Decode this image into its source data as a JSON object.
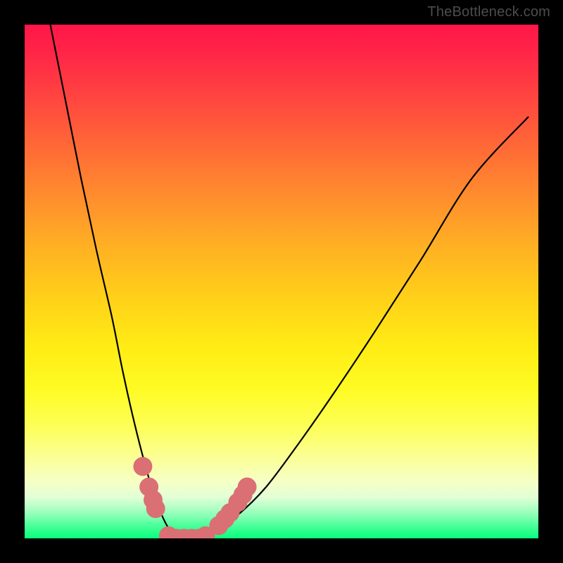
{
  "watermark": "TheBottleneck.com",
  "chart_data": {
    "type": "line",
    "title": "",
    "xlabel": "",
    "ylabel": "",
    "xlim": [
      0,
      100
    ],
    "ylim": [
      0,
      100
    ],
    "grid": false,
    "legend": false,
    "series": [
      {
        "name": "bottleneck-curve",
        "color": "#000000",
        "x": [
          5,
          8,
          11,
          14,
          17,
          19,
          21,
          23,
          25,
          26.5,
          28,
          29.5,
          31,
          33,
          35,
          38,
          42,
          47,
          53,
          60,
          68,
          77,
          87,
          98
        ],
        "y": [
          100,
          85,
          70,
          56,
          43,
          33,
          24,
          16,
          9,
          5,
          2,
          0.5,
          0,
          0,
          0.5,
          2,
          5,
          10,
          18,
          28,
          40,
          54,
          70,
          82
        ]
      }
    ],
    "markers": [
      {
        "x": 23.0,
        "y": 14.0,
        "r": 1.3
      },
      {
        "x": 24.2,
        "y": 10.0,
        "r": 1.3
      },
      {
        "x": 25.0,
        "y": 7.5,
        "r": 1.3
      },
      {
        "x": 25.5,
        "y": 5.8,
        "r": 1.3
      },
      {
        "x": 28.0,
        "y": 0.5,
        "r": 1.3
      },
      {
        "x": 29.5,
        "y": 0.0,
        "r": 1.3
      },
      {
        "x": 31.0,
        "y": 0.0,
        "r": 1.3
      },
      {
        "x": 32.5,
        "y": 0.0,
        "r": 1.3
      },
      {
        "x": 34.0,
        "y": 0.0,
        "r": 1.3
      },
      {
        "x": 35.2,
        "y": 0.5,
        "r": 1.3
      },
      {
        "x": 37.8,
        "y": 2.5,
        "r": 1.3
      },
      {
        "x": 39.0,
        "y": 3.8,
        "r": 1.3
      },
      {
        "x": 40.0,
        "y": 5.0,
        "r": 1.3
      },
      {
        "x": 41.5,
        "y": 7.0,
        "r": 1.3
      },
      {
        "x": 42.5,
        "y": 8.5,
        "r": 1.3
      },
      {
        "x": 43.3,
        "y": 10.0,
        "r": 1.3
      }
    ],
    "marker_color": "#da6f74"
  }
}
